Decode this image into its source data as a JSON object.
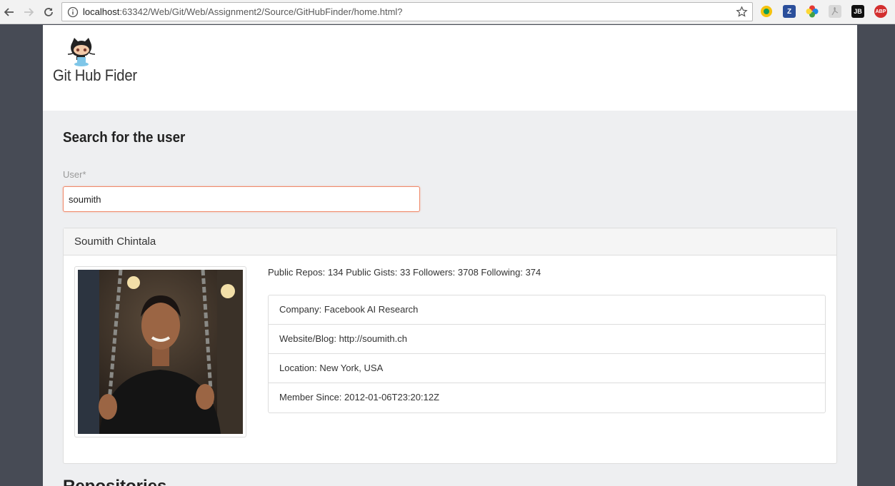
{
  "browser": {
    "url_host": "localhost",
    "url_rest": ":63342/Web/Git/Web/Assignment2/Source/GitHubFinder/home.html?",
    "extensions": [
      "google-drive-icon",
      "zotero-icon",
      "color-picker-icon",
      "pdf-icon",
      "jetbrains-icon",
      "adblock-plus-icon"
    ],
    "ext_labels": {
      "zotero": "Z",
      "jetbrains": "JB",
      "abp": "ABP"
    }
  },
  "header": {
    "brand": "Git Hub Fider"
  },
  "search": {
    "title": "Search for the user",
    "label": "User*",
    "value": "soumith"
  },
  "profile": {
    "name": "Soumith Chintala",
    "stats": "Public Repos: 134 Public Gists: 33 Followers: 3708 Following: 374",
    "details": [
      "Company: Facebook AI Research",
      "Website/Blog: http://soumith.ch",
      "Location: New York, USA",
      "Member Since: 2012-01-06T23:20:12Z"
    ]
  },
  "repos": {
    "title": "Repositories"
  },
  "colors": {
    "accent_border": "#f08a6b",
    "page_bg": "#eeeff1",
    "outer_bg": "#474b55"
  }
}
